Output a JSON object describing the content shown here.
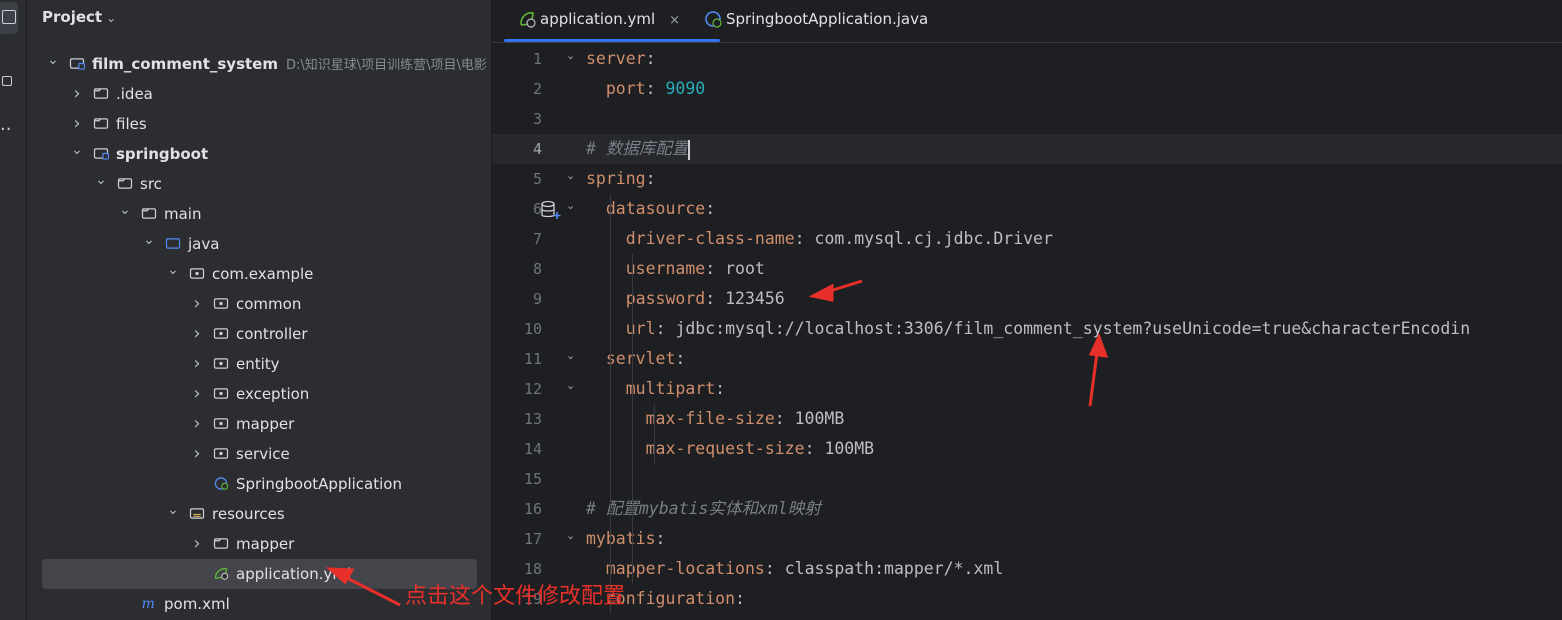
{
  "project_panel": {
    "title": "Project",
    "tree": [
      {
        "label": "film_comment_system",
        "hint": "D:\\知识星球\\项目训练营\\项目\\电影",
        "arrow": "v",
        "icon": "module-folder-icon",
        "bold": true
      },
      {
        "label": ".idea",
        "arrow": ">",
        "icon": "folder-icon"
      },
      {
        "label": "files",
        "arrow": ">",
        "icon": "folder-icon"
      },
      {
        "label": "springboot",
        "arrow": "v",
        "icon": "module-folder-icon",
        "bold": true
      },
      {
        "label": "src",
        "arrow": "v",
        "icon": "folder-icon"
      },
      {
        "label": "main",
        "arrow": "v",
        "icon": "folder-icon"
      },
      {
        "label": "java",
        "arrow": "v",
        "icon": "source-folder-icon"
      },
      {
        "label": "com.example",
        "arrow": "v",
        "icon": "package-icon"
      },
      {
        "label": "common",
        "arrow": ">",
        "icon": "package-icon"
      },
      {
        "label": "controller",
        "arrow": ">",
        "icon": "package-icon"
      },
      {
        "label": "entity",
        "arrow": ">",
        "icon": "package-icon"
      },
      {
        "label": "exception",
        "arrow": ">",
        "icon": "package-icon"
      },
      {
        "label": "mapper",
        "arrow": ">",
        "icon": "package-icon"
      },
      {
        "label": "service",
        "arrow": ">",
        "icon": "package-icon"
      },
      {
        "label": "SpringbootApplication",
        "arrow": "",
        "icon": "spring-class-icon"
      },
      {
        "label": "resources",
        "arrow": "v",
        "icon": "resources-folder-icon"
      },
      {
        "label": "mapper",
        "arrow": ">",
        "icon": "folder-icon"
      },
      {
        "label": "application.yml",
        "arrow": "",
        "icon": "spring-yml-icon",
        "selected": true
      },
      {
        "label": "pom.xml",
        "arrow": "",
        "icon": "maven-icon"
      }
    ]
  },
  "tabs": [
    {
      "label": "application.yml",
      "icon": "spring-yml-icon",
      "active": true,
      "close": "×"
    },
    {
      "label": "SpringbootApplication.java",
      "icon": "spring-class-icon",
      "active": false
    }
  ],
  "editor": {
    "current_line": 4,
    "lines": [
      [
        {
          "t": "server",
          "c": "k"
        },
        {
          "t": ":",
          "c": "p"
        }
      ],
      [
        {
          "t": "  "
        },
        {
          "t": "port",
          "c": "k"
        },
        {
          "t": ": ",
          "c": "p"
        },
        {
          "t": "9090",
          "c": "n"
        }
      ],
      [],
      [
        {
          "t": "# 数据库配置",
          "c": "c"
        }
      ],
      [
        {
          "t": "spring",
          "c": "k"
        },
        {
          "t": ":",
          "c": "p"
        }
      ],
      [
        {
          "t": "  "
        },
        {
          "t": "datasource",
          "c": "k"
        },
        {
          "t": ":",
          "c": "p"
        }
      ],
      [
        {
          "t": "    "
        },
        {
          "t": "driver-class-name",
          "c": "k"
        },
        {
          "t": ": ",
          "c": "p"
        },
        {
          "t": "com.mysql.cj.jdbc.Driver",
          "c": "v"
        }
      ],
      [
        {
          "t": "    "
        },
        {
          "t": "username",
          "c": "k"
        },
        {
          "t": ": ",
          "c": "p"
        },
        {
          "t": "root",
          "c": "v"
        }
      ],
      [
        {
          "t": "    "
        },
        {
          "t": "password",
          "c": "k"
        },
        {
          "t": ": ",
          "c": "p"
        },
        {
          "t": "123456",
          "c": "v"
        }
      ],
      [
        {
          "t": "    "
        },
        {
          "t": "url",
          "c": "k"
        },
        {
          "t": ": ",
          "c": "p"
        },
        {
          "t": "jdbc:mysql://localhost:3306/film_comment_system?useUnicode=true&characterEncodin",
          "c": "v"
        }
      ],
      [
        {
          "t": "  "
        },
        {
          "t": "servlet",
          "c": "k"
        },
        {
          "t": ":",
          "c": "p"
        }
      ],
      [
        {
          "t": "    "
        },
        {
          "t": "multipart",
          "c": "k"
        },
        {
          "t": ":",
          "c": "p"
        }
      ],
      [
        {
          "t": "      "
        },
        {
          "t": "max-file-size",
          "c": "k"
        },
        {
          "t": ": ",
          "c": "p"
        },
        {
          "t": "100MB",
          "c": "v"
        }
      ],
      [
        {
          "t": "      "
        },
        {
          "t": "max-request-size",
          "c": "k"
        },
        {
          "t": ": ",
          "c": "p"
        },
        {
          "t": "100MB",
          "c": "v"
        }
      ],
      [],
      [
        {
          "t": "# 配置mybatis实体和xml映射",
          "c": "c"
        }
      ],
      [
        {
          "t": "mybatis",
          "c": "k"
        },
        {
          "t": ":",
          "c": "p"
        }
      ],
      [
        {
          "t": "  "
        },
        {
          "t": "mapper-locations",
          "c": "k"
        },
        {
          "t": ": ",
          "c": "p"
        },
        {
          "t": "classpath:mapper/*.xml",
          "c": "v"
        }
      ],
      [
        {
          "t": "  "
        },
        {
          "t": "configuration",
          "c": "k"
        },
        {
          "t": ":",
          "c": "p"
        }
      ]
    ],
    "fold_lines": [
      1,
      5,
      6,
      11,
      12,
      17
    ]
  },
  "annotation": {
    "text": "点击这个文件修改配置",
    "color": "#e8302a"
  },
  "colors": {
    "accent": "#3574f0",
    "keyword": "#cf8e6d",
    "number": "#2aacb8",
    "comment": "#7a7e85"
  }
}
